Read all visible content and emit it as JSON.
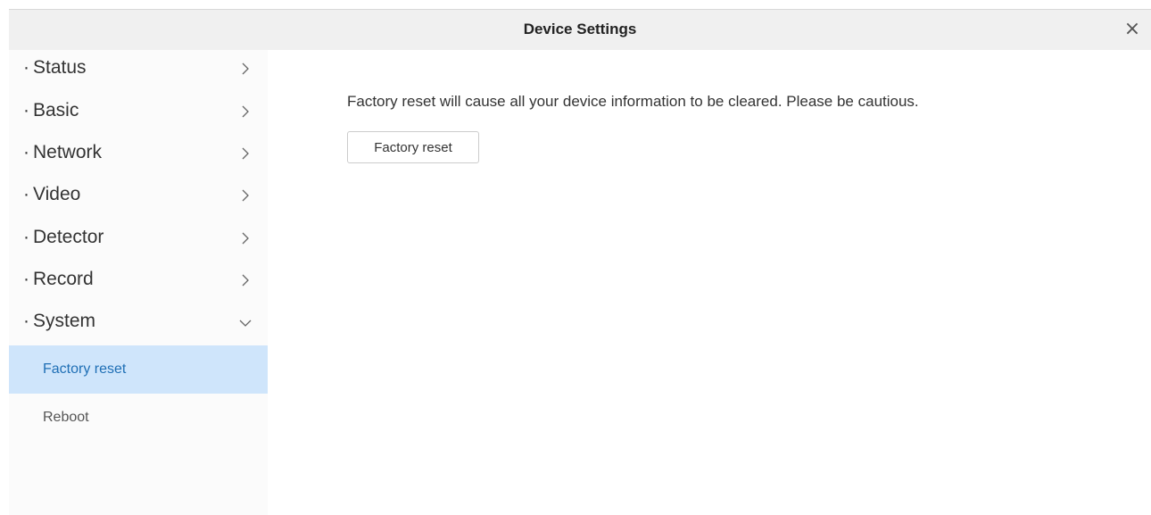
{
  "window": {
    "title": "Device Settings",
    "close_icon": "close-icon",
    "close_glyph": "×"
  },
  "sidebar": {
    "dot": "·",
    "items": [
      {
        "label": "Status",
        "icon": "chevron-right-icon",
        "expanded": false
      },
      {
        "label": "Basic",
        "icon": "chevron-right-icon",
        "expanded": false
      },
      {
        "label": "Network",
        "icon": "chevron-right-icon",
        "expanded": false
      },
      {
        "label": "Video",
        "icon": "chevron-right-icon",
        "expanded": false
      },
      {
        "label": "Detector",
        "icon": "chevron-right-icon",
        "expanded": false
      },
      {
        "label": "Record",
        "icon": "chevron-right-icon",
        "expanded": false
      },
      {
        "label": "System",
        "icon": "chevron-down-icon",
        "expanded": true
      }
    ],
    "system_subitems": [
      {
        "label": "Factory reset",
        "active": true
      },
      {
        "label": "Reboot",
        "active": false
      }
    ]
  },
  "main": {
    "warning": "Factory reset will cause all your device information to be cleared. Please be cautious.",
    "reset_button_label": "Factory reset"
  },
  "colors": {
    "active_bg": "#cfe5fb",
    "active_text": "#1f6fb5",
    "title_bar_bg": "#f0f0f0",
    "sidebar_bg": "#fbfbfb"
  }
}
